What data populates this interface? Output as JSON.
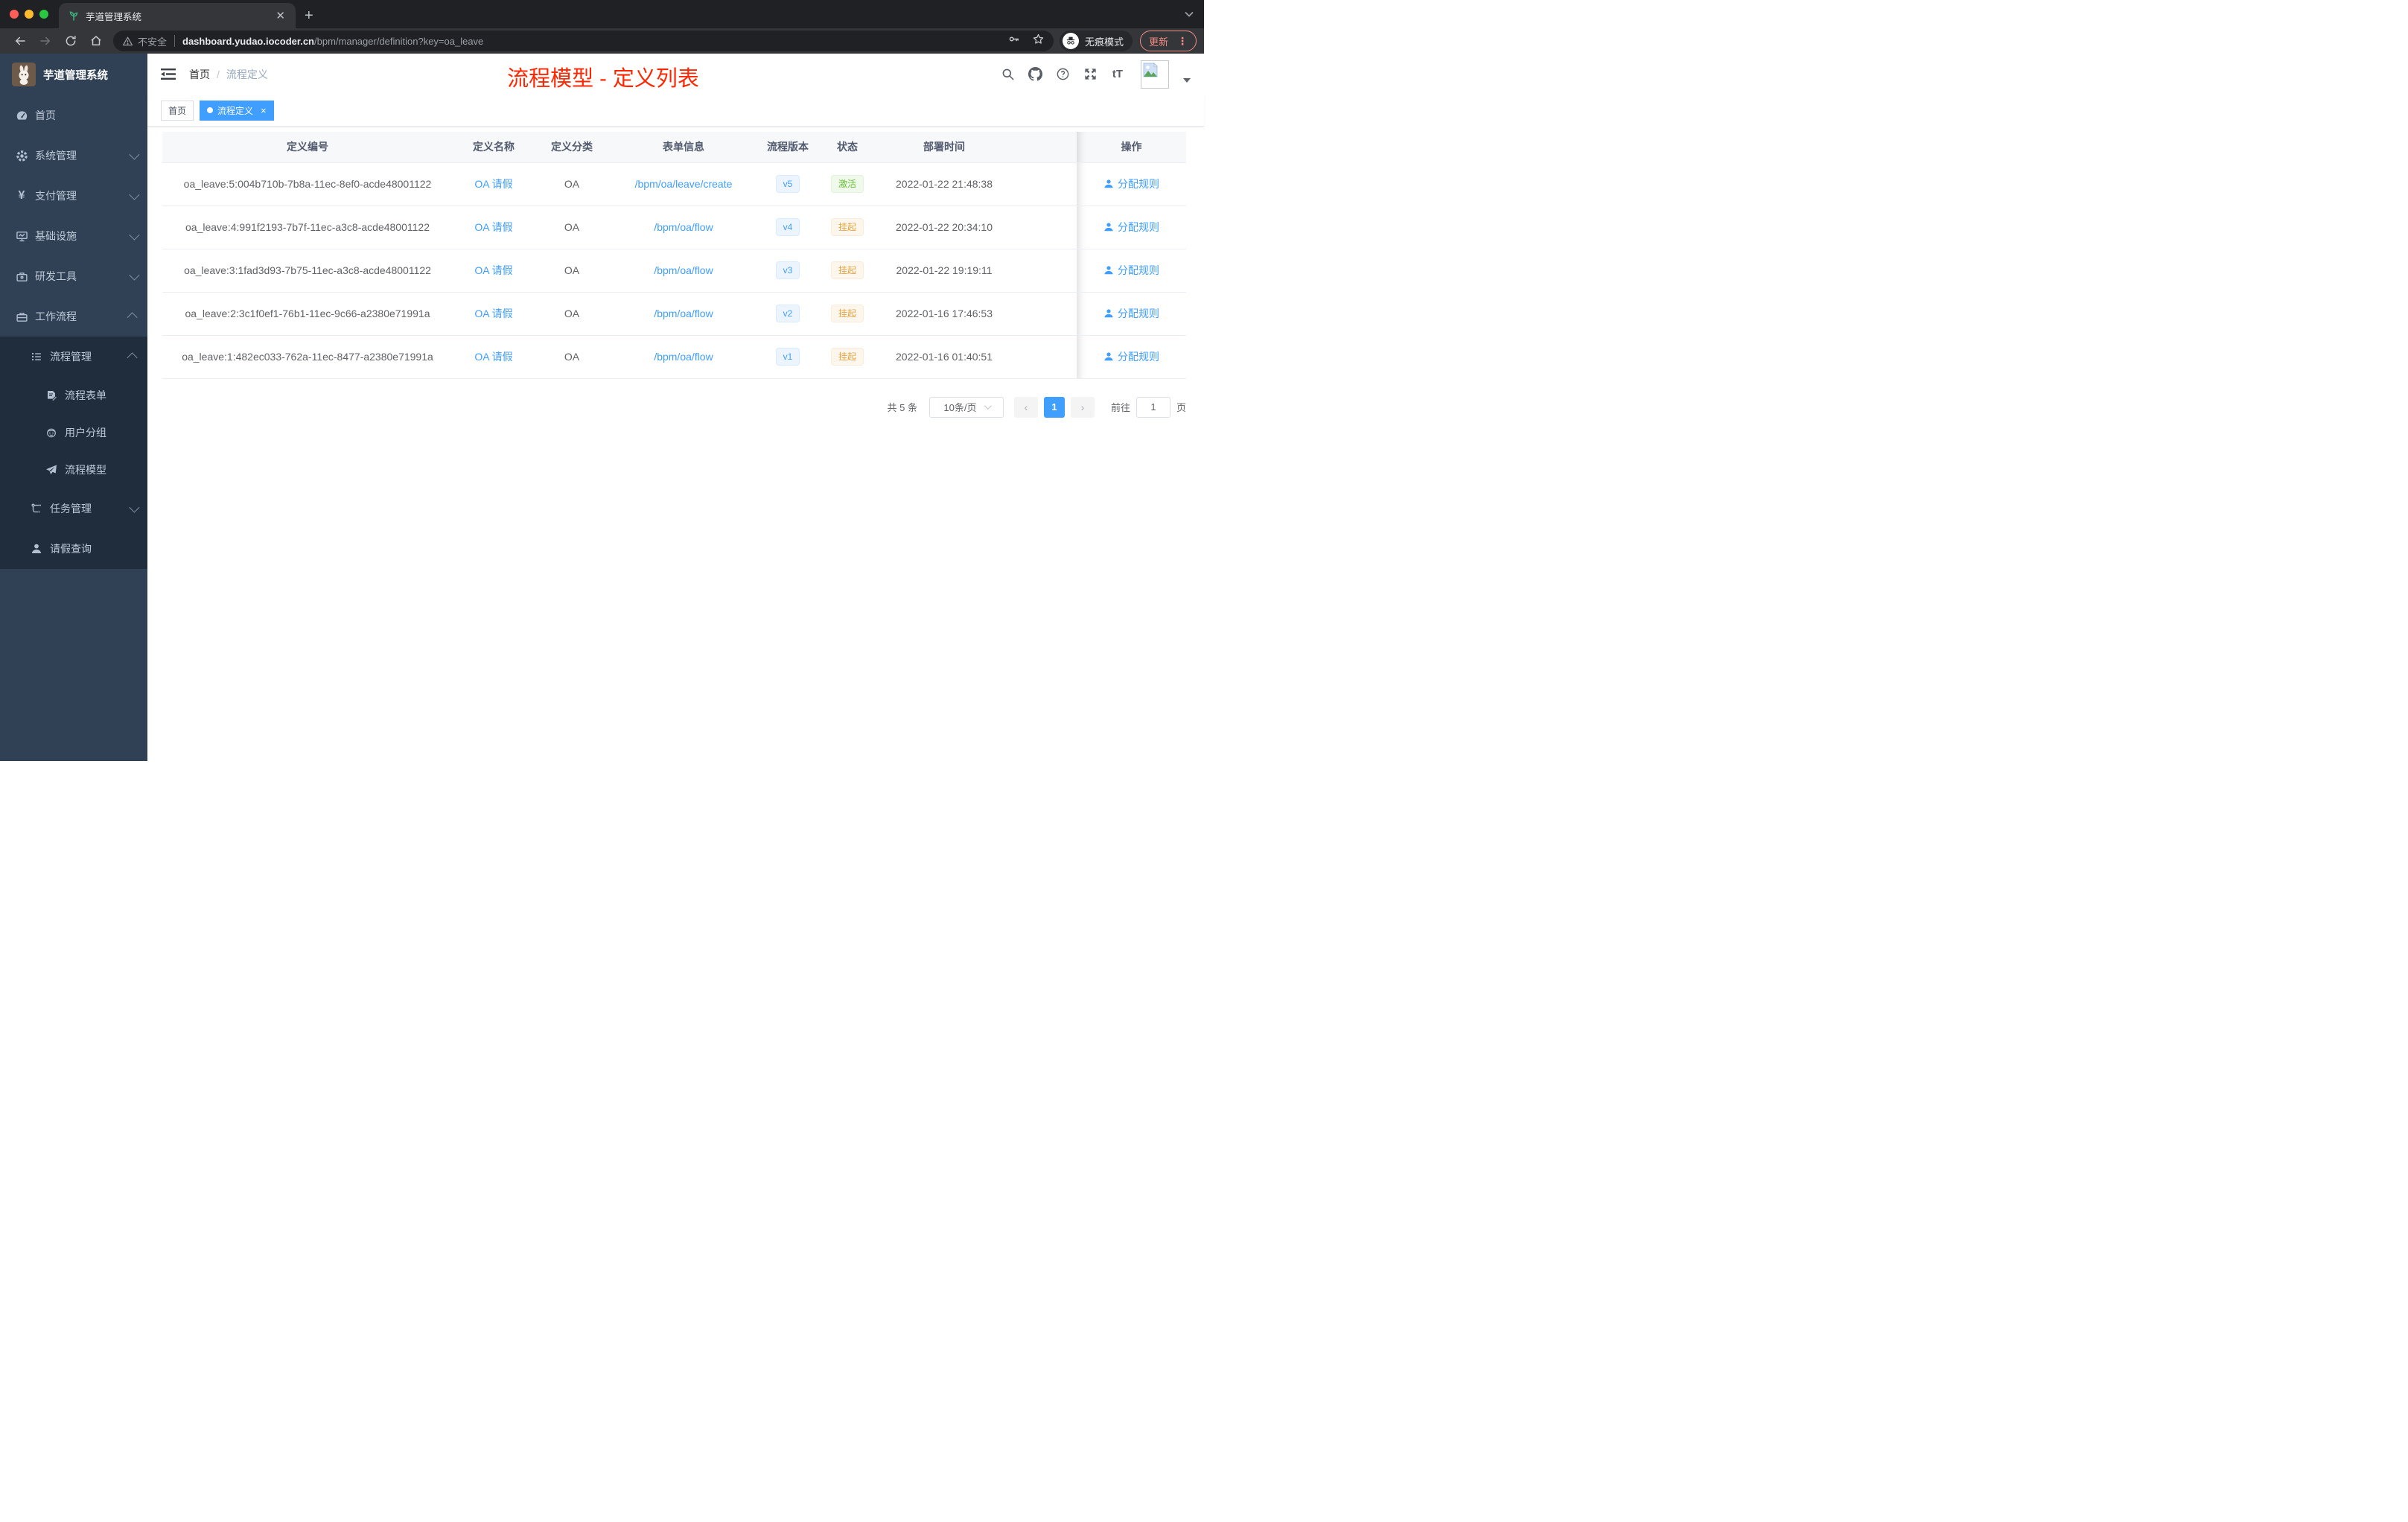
{
  "browser": {
    "tab_title": "芋道管理系统",
    "new_tab_button": "+",
    "security_label": "不安全",
    "url_host": "dashboard.yudao.iocoder.cn",
    "url_path": "/bpm/manager/definition?key=oa_leave",
    "incognito_label": "无痕模式",
    "update_label": "更新",
    "menu_dots": "⋮"
  },
  "sidebar": {
    "logo_title": "芋道管理系统",
    "menu": [
      {
        "label": "首页",
        "icon": "dashboard-icon"
      },
      {
        "label": "系统管理",
        "icon": "gear-icon"
      },
      {
        "label": "支付管理",
        "icon": "yen-icon"
      },
      {
        "label": "基础设施",
        "icon": "monitor-icon"
      },
      {
        "label": "研发工具",
        "icon": "toolbox-icon"
      },
      {
        "label": "工作流程",
        "icon": "briefcase-icon",
        "expanded": true,
        "children": [
          {
            "label": "流程管理",
            "icon": "list-icon",
            "expanded": true,
            "children": [
              {
                "label": "流程表单",
                "icon": "form-icon"
              },
              {
                "label": "用户分组",
                "icon": "robot-icon"
              },
              {
                "label": "流程模型",
                "icon": "paper-plane-icon"
              }
            ]
          },
          {
            "label": "任务管理",
            "icon": "flow-icon"
          },
          {
            "label": "请假查询",
            "icon": "user-icon"
          }
        ]
      }
    ]
  },
  "header": {
    "breadcrumb": {
      "home": "首页",
      "separator": "/",
      "current": "流程定义"
    },
    "annotation": "流程模型 - 定义列表",
    "annotation_color": "#ff2600",
    "icons": [
      "search-icon",
      "github-icon",
      "help-icon",
      "fullscreen-icon",
      "font-size-icon",
      "avatar",
      "caret-down-icon"
    ]
  },
  "tags": [
    {
      "label": "首页",
      "active": false
    },
    {
      "label": "流程定义",
      "active": true,
      "close": "×"
    }
  ],
  "table": {
    "headers": [
      "定义编号",
      "定义名称",
      "定义分类",
      "表单信息",
      "流程版本",
      "状态",
      "部署时间",
      "操作"
    ],
    "action_label": "分配规则",
    "rows": [
      {
        "id": "oa_leave:5:004b710b-7b8a-11ec-8ef0-acde48001122",
        "name": "OA 请假",
        "category": "OA",
        "form": "/bpm/oa/leave/create",
        "version": "v5",
        "status": "激活",
        "deployed_at": "2022-01-22 21:48:38"
      },
      {
        "id": "oa_leave:4:991f2193-7b7f-11ec-a3c8-acde48001122",
        "name": "OA 请假",
        "category": "OA",
        "form": "/bpm/oa/flow",
        "version": "v4",
        "status": "挂起",
        "deployed_at": "2022-01-22 20:34:10"
      },
      {
        "id": "oa_leave:3:1fad3d93-7b75-11ec-a3c8-acde48001122",
        "name": "OA 请假",
        "category": "OA",
        "form": "/bpm/oa/flow",
        "version": "v3",
        "status": "挂起",
        "deployed_at": "2022-01-22 19:19:11"
      },
      {
        "id": "oa_leave:2:3c1f0ef1-76b1-11ec-9c66-a2380e71991a",
        "name": "OA 请假",
        "category": "OA",
        "form": "/bpm/oa/flow",
        "version": "v2",
        "status": "挂起",
        "deployed_at": "2022-01-16 17:46:53"
      },
      {
        "id": "oa_leave:1:482ec033-762a-11ec-8477-a2380e71991a",
        "name": "OA 请假",
        "category": "OA",
        "form": "/bpm/oa/flow",
        "version": "v1",
        "status": "挂起",
        "deployed_at": "2022-01-16 01:40:51"
      }
    ]
  },
  "pagination": {
    "total": "共 5 条",
    "page_size": "10条/页",
    "current": "1",
    "goto_label": "前往",
    "goto_value": "1",
    "unit": "页"
  },
  "theme": {
    "accent": "#409eff",
    "success": "#67c23a",
    "warning": "#e6a23c",
    "annotation_red": "#ff2600",
    "sidebar_bg": "#304156",
    "submenu_bg": "#1f2d3d"
  }
}
